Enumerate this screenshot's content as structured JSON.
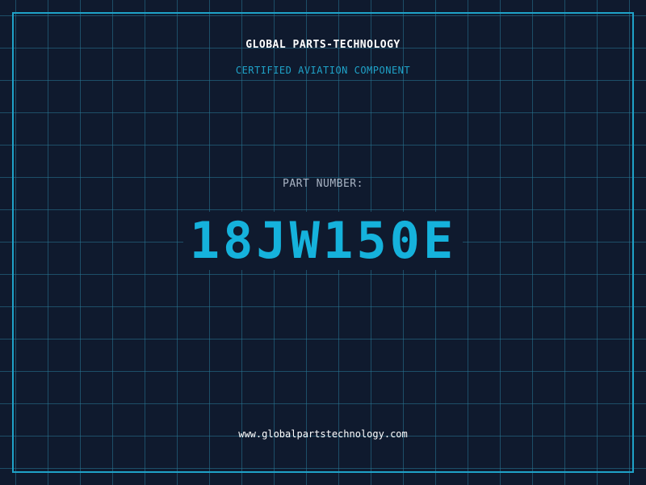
{
  "header": {
    "company": "GLOBAL PARTS-TECHNOLOGY",
    "subtitle": "CERTIFIED AVIATION COMPONENT"
  },
  "part": {
    "label": "PART NUMBER:",
    "number": "18JW150E"
  },
  "footer": {
    "url": "www.globalpartstechnology.com"
  },
  "colors": {
    "background": "#0f1a2e",
    "accent": "#1fa2c8",
    "part_number": "#15b2dc",
    "grid": "#28789a"
  }
}
